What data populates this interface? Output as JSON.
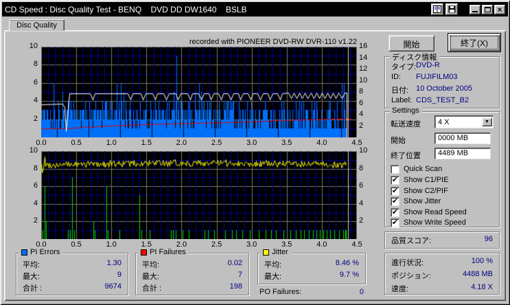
{
  "window": {
    "title": "CD Speed : Disc Quality Test - BENQ    DVD DD DW1640    BSLB",
    "titlebar_icons": [
      "report-icon",
      "save-icon",
      "minimize-icon",
      "maximize-icon",
      "close-icon"
    ],
    "close_glyph": "×"
  },
  "tab": {
    "label": "Disc Quality"
  },
  "charts_header": {
    "recorded_with": "recorded with PIONEER DVD-RW  DVR-110  v1.22"
  },
  "buttons": {
    "start": "開始",
    "exit": "終了(X)"
  },
  "disc_info": {
    "caption": "ディスク情報",
    "rows": [
      {
        "label": "タイプ:",
        "value": "DVD-R"
      },
      {
        "label": "ID:",
        "value": "FUJIFILM03"
      },
      {
        "label": "日付:",
        "value": "10 October 2005"
      },
      {
        "label": "Label:",
        "value": "CDS_TEST_B2"
      }
    ]
  },
  "settings": {
    "caption": "Settings",
    "speed_label": "転送速度",
    "speed_value": "4 X",
    "start_label": "開始",
    "start_value": "0000 MB",
    "end_label": "終了位置",
    "end_value": "4489 MB",
    "checkboxes": [
      {
        "label": "Quick Scan",
        "checked": false
      },
      {
        "label": "Show C1/PIE",
        "checked": true
      },
      {
        "label": "Show C2/PIF",
        "checked": true
      },
      {
        "label": "Show Jitter",
        "checked": true
      },
      {
        "label": "Show Read Speed",
        "checked": true
      },
      {
        "label": "Show Write Speed",
        "checked": true
      }
    ],
    "check_glyph": "✔"
  },
  "quality": {
    "label": "品質スコア:",
    "value": "96"
  },
  "progress": {
    "rows": [
      {
        "label": "進行状況:",
        "value": "100 %"
      },
      {
        "label": "ポジション:",
        "value": "4488 MB"
      },
      {
        "label": "速度:",
        "value": "4.18 X"
      }
    ]
  },
  "legends": {
    "pi_errors": {
      "caption": "PI Errors",
      "color": "#0070f8",
      "rows": [
        {
          "label": "平均:",
          "value": "1.30"
        },
        {
          "label": "最大:",
          "value": "9"
        },
        {
          "label": "合計 :",
          "value": "9674"
        }
      ]
    },
    "pi_failures": {
      "caption": "PI Failures",
      "color": "#ff0000",
      "rows": [
        {
          "label": "平均:",
          "value": "0.02"
        },
        {
          "label": "最大:",
          "value": "7"
        },
        {
          "label": "合計 :",
          "value": "198"
        }
      ]
    },
    "jitter": {
      "caption": "Jitter",
      "color": "#ffff00",
      "rows": [
        {
          "label": "平均:",
          "value": "8.46 %"
        },
        {
          "label": "最大:",
          "value": "9.7 %"
        }
      ]
    },
    "po_failures": {
      "label": "PO Failures:",
      "value": "0"
    }
  },
  "chart_data": [
    {
      "id": "pi_errors_speed",
      "type": "bar",
      "title": "PI Errors with read/write speed overlay",
      "x_range": [
        0,
        4.5
      ],
      "x_ticks": [
        "0.0",
        "0.5",
        "1.0",
        "1.5",
        "2.0",
        "2.5",
        "3.0",
        "3.5",
        "4.0",
        "4.5"
      ],
      "y_left_range": [
        0,
        10
      ],
      "y_left_ticks": [
        2,
        4,
        6,
        8,
        10
      ],
      "y_right_range": [
        0,
        16
      ],
      "y_right_ticks": [
        2,
        4,
        6,
        8,
        10,
        12,
        14,
        16
      ],
      "grid": {
        "minor_color": "#000090",
        "major_color": "#787878",
        "x_minor_step": 0.1,
        "x_major_step": 0.5,
        "y_step": 1
      },
      "scan_end_x": 4.37,
      "series": [
        {
          "name": "PI Errors",
          "kind": "noise-bars",
          "color": "#0070f8",
          "step": 0.01,
          "end_x": 4.35,
          "seed": 1337,
          "levels": [
            1,
            2,
            2,
            3,
            3,
            4
          ],
          "late_drop_x": 2.9,
          "spikes": [
            [
              0.18,
              6
            ],
            [
              0.3,
              5
            ],
            [
              1.08,
              6
            ],
            [
              1.13,
              6
            ],
            [
              1.17,
              5
            ],
            [
              1.5,
              5
            ],
            [
              1.93,
              9
            ],
            [
              2.25,
              6
            ],
            [
              2.28,
              5
            ],
            [
              4.28,
              6
            ],
            [
              4.31,
              6
            ]
          ],
          "avg": 1.3,
          "max": 9,
          "total": 9674
        },
        {
          "name": "Write Speed",
          "kind": "line",
          "color": "#e00000",
          "points": [
            [
              0,
              0.95
            ],
            [
              0.35,
              1.02
            ],
            [
              0.6,
              1.12
            ],
            [
              1.0,
              1.3
            ],
            [
              1.4,
              1.42
            ],
            [
              1.8,
              1.52
            ],
            [
              2.2,
              1.62
            ],
            [
              2.6,
              1.7
            ],
            [
              3.0,
              1.78
            ],
            [
              3.4,
              1.86
            ],
            [
              3.8,
              1.95
            ],
            [
              4.2,
              2.02
            ],
            [
              4.42,
              2.06
            ]
          ]
        },
        {
          "name": "Read Speed",
          "kind": "read-line",
          "color": "#ffffff",
          "start": [
            [
              0,
              3.6
            ],
            [
              0.3,
              3.75
            ],
            [
              0.33,
              3.3
            ],
            [
              0.355,
              0.65
            ],
            [
              0.38,
              3.2
            ],
            [
              0.405,
              4.85
            ]
          ],
          "plateau": 4.85,
          "dip_depth": 0.65,
          "dips": [
            0.73,
            1.27,
            1.45,
            1.62,
            1.78,
            1.95,
            2.12,
            2.28,
            2.42,
            2.56,
            2.7,
            2.84,
            2.98,
            3.12,
            3.26,
            3.4
          ],
          "osc": {
            "from": 3.52,
            "to": 4.35,
            "hi": 4.9,
            "lo": 4.35,
            "period": 0.08
          },
          "end_x": 4.35
        }
      ]
    },
    {
      "id": "pi_failures_jitter",
      "type": "bar",
      "title": "PI Failures with jitter overlay",
      "x_range": [
        0,
        4.5
      ],
      "x_ticks": [
        "0.0",
        "0.5",
        "1.0",
        "1.5",
        "2.0",
        "2.5",
        "3.0",
        "3.5",
        "4.0",
        "4.5"
      ],
      "y_left_range": [
        0,
        10
      ],
      "y_left_ticks": [
        2,
        4,
        6,
        8,
        10
      ],
      "y_right_range": [
        0,
        10
      ],
      "y_right_ticks": [
        2,
        4,
        6,
        8,
        10
      ],
      "grid": {
        "minor_color": "#000090",
        "major_color": "#787878",
        "x_minor_step": 0.1,
        "x_major_step": 0.5,
        "y_step": 1
      },
      "scan_end_x": 4.37,
      "series": [
        {
          "name": "PI Failures",
          "kind": "bars",
          "color": "#00e000",
          "bars": [
            [
              0.02,
              1
            ],
            [
              0.05,
              6
            ],
            [
              0.07,
              2
            ],
            [
              0.38,
              1
            ],
            [
              0.41,
              1
            ],
            [
              0.44,
              7
            ],
            [
              0.47,
              1
            ],
            [
              0.74,
              2
            ],
            [
              0.76,
              1
            ],
            [
              0.93,
              6
            ],
            [
              0.95,
              1
            ],
            [
              1.12,
              1
            ],
            [
              1.4,
              5
            ],
            [
              1.43,
              1
            ],
            [
              1.55,
              1
            ],
            [
              1.85,
              1
            ],
            [
              1.88,
              1
            ],
            [
              1.92,
              1
            ],
            [
              2.02,
              1
            ],
            [
              2.1,
              1
            ],
            [
              2.33,
              1
            ],
            [
              2.38,
              1
            ],
            [
              2.47,
              1
            ],
            [
              2.62,
              1
            ],
            [
              2.72,
              1
            ],
            [
              2.78,
              1
            ],
            [
              2.87,
              1
            ],
            [
              2.97,
              1
            ],
            [
              3.1,
              1
            ],
            [
              3.2,
              1
            ],
            [
              3.28,
              1
            ],
            [
              3.35,
              1
            ],
            [
              3.45,
              1
            ],
            [
              3.55,
              1
            ],
            [
              3.63,
              1
            ],
            [
              3.7,
              1
            ],
            [
              3.75,
              1
            ],
            [
              3.82,
              1
            ],
            [
              3.87,
              1
            ],
            [
              3.92,
              1
            ],
            [
              3.97,
              1
            ],
            [
              4.02,
              1
            ],
            [
              4.07,
              1
            ],
            [
              4.12,
              1
            ],
            [
              4.18,
              1
            ],
            [
              4.25,
              1
            ],
            [
              4.3,
              1
            ],
            [
              4.33,
              1,
              0.02
            ]
          ],
          "avg": 0.02,
          "max": 7,
          "total": 198
        },
        {
          "name": "Jitter",
          "kind": "jitter-line",
          "color": "#ffff00",
          "seed": 99,
          "step": 0.012,
          "end_x": 4.35,
          "mean": 8.45,
          "amp": 0.75,
          "clamp": [
            7.7,
            9.55
          ],
          "start_points": [
            [
              0,
              8.6
            ],
            [
              0.012,
              7.6
            ],
            [
              0.03,
              8.1
            ],
            [
              0.05,
              9.4
            ]
          ],
          "avg_pct": 8.46,
          "max_pct": 9.7
        }
      ]
    }
  ]
}
